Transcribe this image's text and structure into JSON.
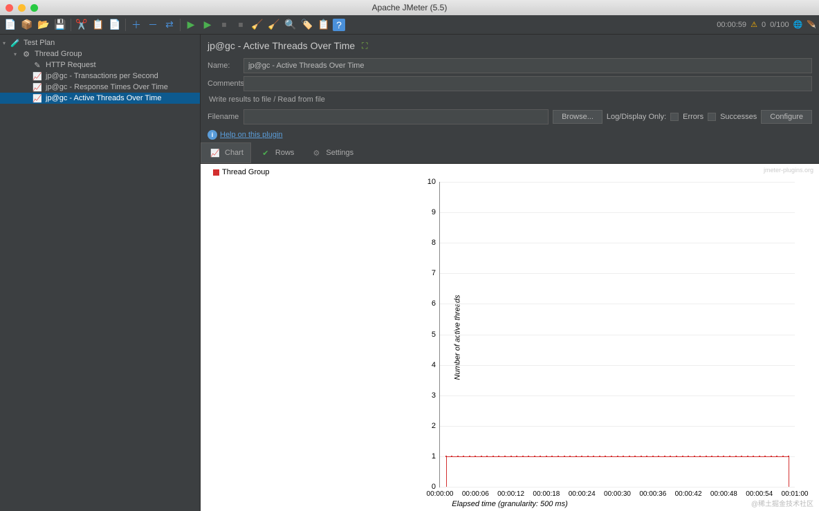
{
  "window": {
    "title": "Apache JMeter (5.5)"
  },
  "toolbar_status": {
    "time": "00:00:59",
    "warn_count": "0",
    "threads": "0/100"
  },
  "tree": {
    "items": [
      {
        "label": "Test Plan",
        "icon": "🧪",
        "indent": 0
      },
      {
        "label": "Thread Group",
        "icon": "⚙",
        "indent": 1
      },
      {
        "label": "HTTP Request",
        "icon": "✎",
        "indent": 2
      },
      {
        "label": "jp@gc - Transactions per Second",
        "icon": "📈",
        "indent": 2
      },
      {
        "label": "jp@gc - Response Times Over Time",
        "icon": "📈",
        "indent": 2
      },
      {
        "label": "jp@gc - Active Threads Over Time",
        "icon": "📈",
        "indent": 2,
        "selected": true
      }
    ]
  },
  "panel": {
    "title": "jp@gc - Active Threads Over Time",
    "labels": {
      "name": "Name:",
      "comments": "Comments:",
      "section": "Write results to file / Read from file",
      "filename": "Filename",
      "browse": "Browse...",
      "logdisplay": "Log/Display Only:",
      "errors": "Errors",
      "successes": "Successes",
      "configure": "Configure",
      "help": "Help on this plugin"
    },
    "values": {
      "name": "jp@gc - Active Threads Over Time",
      "comments": "",
      "filename": ""
    },
    "tabs": [
      {
        "label": "Chart"
      },
      {
        "label": "Rows"
      },
      {
        "label": "Settings"
      }
    ]
  },
  "chart_data": {
    "type": "line",
    "series": [
      {
        "name": "Thread Group",
        "color": "#d32f2f",
        "x": [
          "00:00:01",
          "00:00:02",
          "00:00:03",
          "00:00:04",
          "00:00:05",
          "00:00:06",
          "00:00:07",
          "00:00:08",
          "00:00:09",
          "00:00:10",
          "00:00:11",
          "00:00:12",
          "00:00:13",
          "00:00:14",
          "00:00:15",
          "00:00:16",
          "00:00:17",
          "00:00:18",
          "00:00:19",
          "00:00:20",
          "00:00:21",
          "00:00:22",
          "00:00:23",
          "00:00:24",
          "00:00:25",
          "00:00:26",
          "00:00:27",
          "00:00:28",
          "00:00:29",
          "00:00:30",
          "00:00:31",
          "00:00:32",
          "00:00:33",
          "00:00:34",
          "00:00:35",
          "00:00:36",
          "00:00:37",
          "00:00:38",
          "00:00:39",
          "00:00:40",
          "00:00:41",
          "00:00:42",
          "00:00:43",
          "00:00:44",
          "00:00:45",
          "00:00:46",
          "00:00:47",
          "00:00:48",
          "00:00:49",
          "00:00:50",
          "00:00:51",
          "00:00:52",
          "00:00:53",
          "00:00:54",
          "00:00:55",
          "00:00:56",
          "00:00:57",
          "00:00:58",
          "00:00:59"
        ],
        "y": [
          1,
          1,
          1,
          1,
          1,
          1,
          1,
          1,
          1,
          1,
          1,
          1,
          1,
          1,
          1,
          1,
          1,
          1,
          1,
          1,
          1,
          1,
          1,
          1,
          1,
          1,
          1,
          1,
          1,
          1,
          1,
          1,
          1,
          1,
          1,
          1,
          1,
          1,
          1,
          1,
          1,
          1,
          1,
          1,
          1,
          1,
          1,
          1,
          1,
          1,
          1,
          1,
          1,
          1,
          1,
          1,
          1,
          1,
          1
        ]
      }
    ],
    "ylabel": "Number of active threads",
    "xlabel": "Elapsed time (granularity: 500 ms)",
    "ylim": [
      0,
      10
    ],
    "yticks": [
      0,
      1,
      2,
      3,
      4,
      5,
      6,
      7,
      8,
      9,
      10
    ],
    "xticks": [
      "00:00:00",
      "00:00:06",
      "00:00:12",
      "00:00:18",
      "00:00:24",
      "00:00:30",
      "00:00:36",
      "00:00:42",
      "00:00:48",
      "00:00:54",
      "00:01:00"
    ],
    "watermark": "jmeter-plugins.org",
    "watermark2": "@稀土掘金技术社区"
  }
}
